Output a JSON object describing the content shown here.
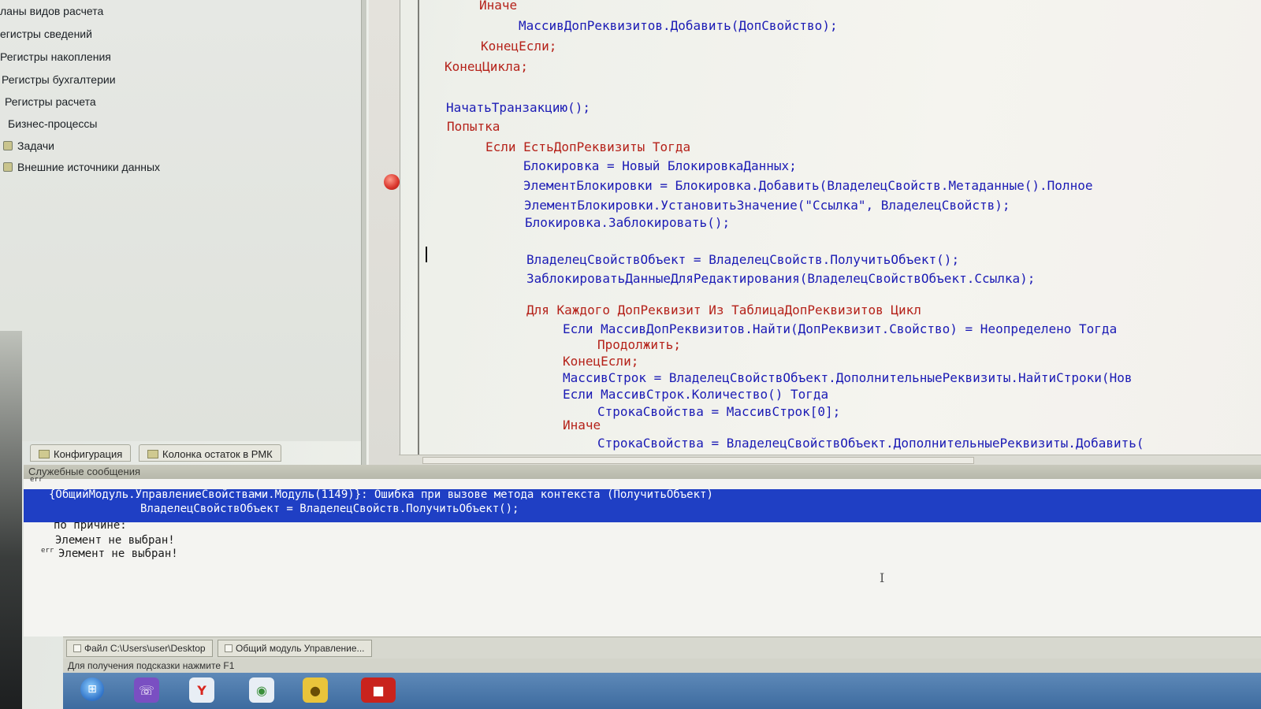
{
  "tree": {
    "items": [
      {
        "label": "ланы видов расчета"
      },
      {
        "label": "егистры сведений"
      },
      {
        "label": "Регистры накопления"
      },
      {
        "label": "Регистры бухгалтерии"
      },
      {
        "label": "Регистры расчета"
      },
      {
        "label": "Бизнес-процессы"
      },
      {
        "label": "Задачи"
      },
      {
        "label": "Внешние источники данных"
      }
    ]
  },
  "editor": {
    "lines": [
      "Иначе",
      "МассивДопРеквизитов.Добавить(ДопСвойство);",
      "КонецЕсли;",
      "КонецЦикла;",
      "НачатьТранзакцию();",
      "Попытка",
      "Если ЕстьДопРеквизиты Тогда",
      "Блокировка = Новый БлокировкаДанных;",
      "ЭлементБлокировки = Блокировка.Добавить(ВладелецСвойств.Метаданные().Полное",
      "ЭлементБлокировки.УстановитьЗначение(\"Ссылка\", ВладелецСвойств);",
      "Блокировка.Заблокировать();",
      "ВладелецСвойствОбъект = ВладелецСвойств.ПолучитьОбъект();",
      "ЗаблокироватьДанныеДляРедактирования(ВладелецСвойствОбъект.Ссылка);",
      "Для Каждого ДопРеквизит Из ТаблицаДопРеквизитов Цикл",
      "Если МассивДопРеквизитов.Найти(ДопРеквизит.Свойство) = Неопределено Тогда",
      "Продолжить;",
      "КонецЕсли;",
      "МассивСтрок = ВладелецСвойствОбъект.ДополнительныеРеквизиты.НайтиСтроки(Нов",
      "Если МассивСтрок.Количество() Тогда",
      "СтрокаСвойства = МассивСтрок[0];",
      "Иначе",
      "СтрокаСвойства = ВладелецСвойствОбъект.ДополнительныеРеквизиты.Добавить("
    ]
  },
  "tabs": {
    "configuration": "Конфигурация",
    "rmk_column": "Колонка остаток в РМК"
  },
  "messages": {
    "header": "Служебные сообщения",
    "err_label": "err",
    "selected": "{ОбщийМодуль.УправлениеСвойствами.Модуль(1149)}: Ошибка при вызове метода контекста (ПолучитьОбъект)",
    "code": "ВладелецСвойствОбъект = ВладелецСвойств.ПолучитьОбъект();",
    "reason": "по причине:",
    "not_selected_1": "Элемент не выбран!",
    "not_selected_2": "Элемент не выбран!"
  },
  "window_tabs": {
    "file": "Файл C:\\Users\\user\\Desktop",
    "module": "Общий модуль Управление..."
  },
  "status": {
    "hint": "Для получения подсказки нажмите F1"
  },
  "colors": {
    "code_blue": "#1b1bb5",
    "keyword_red": "#b5221a",
    "selection_blue": "#1f3fc4"
  }
}
